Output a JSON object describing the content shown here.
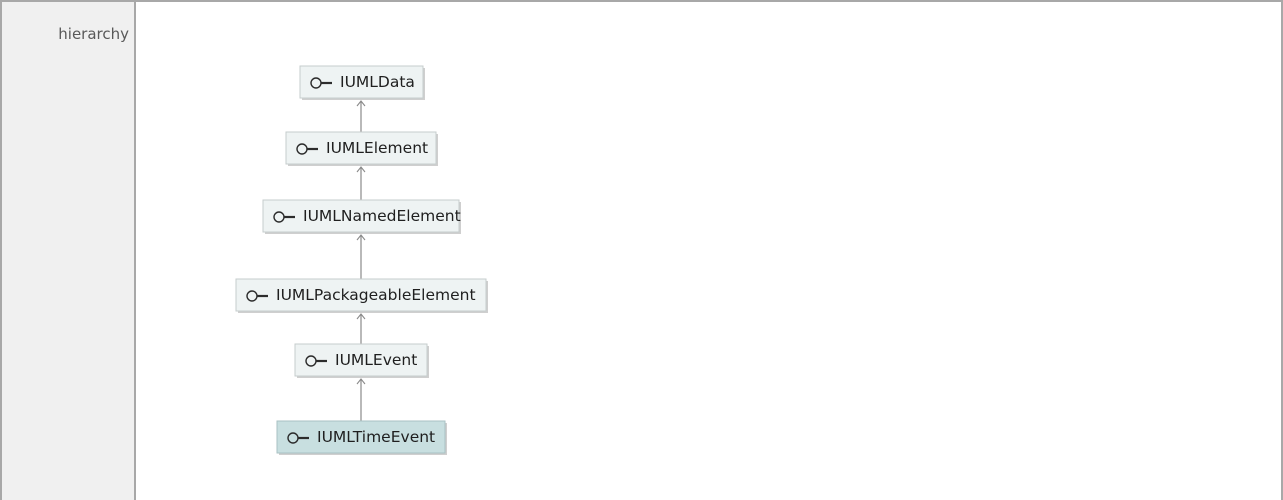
{
  "section_label": "hierarchy",
  "icon_type": "interface-lollipop-icon",
  "colors": {
    "node_fill": "#eef3f3",
    "node_highlight_fill": "#c8dfe0",
    "border": "#a8a8a8",
    "label_cell": "#f0f0f0"
  },
  "hierarchy": [
    {
      "name": "IUMLData",
      "highlight": false
    },
    {
      "name": "IUMLElement",
      "highlight": false
    },
    {
      "name": "IUMLNamedElement",
      "highlight": false
    },
    {
      "name": "IUMLPackageableElement",
      "highlight": false
    },
    {
      "name": "IUMLEvent",
      "highlight": false
    },
    {
      "name": "IUMLTimeEvent",
      "highlight": true
    }
  ]
}
